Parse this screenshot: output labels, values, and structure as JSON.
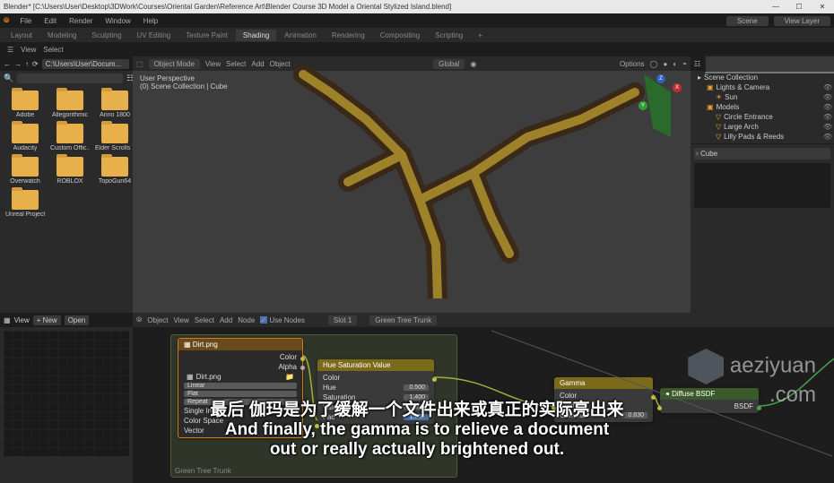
{
  "title": "Blender* [C:\\Users\\User\\Desktop\\3DWork\\Courses\\Oriental Garden\\Reference Art\\Blender Course 3D Model a Oriental Stylized Island.blend]",
  "menubar": [
    "File",
    "Edit",
    "Render",
    "Window",
    "Help"
  ],
  "workspaces": [
    "Layout",
    "Modeling",
    "Sculpting",
    "UV Editing",
    "Texture Paint",
    "Shading",
    "Animation",
    "Rendering",
    "Compositing",
    "Scripting"
  ],
  "workspace_active": "Shading",
  "scene_label": "Scene",
  "viewlayer_label": "View Layer",
  "topbar": {
    "view": "View",
    "select": "Select"
  },
  "filebrowser": {
    "path": "C:\\Users\\User\\Docum...",
    "search_placeholder": "",
    "folders": [
      "Adobe",
      "Allegorithmic",
      "Anno 1800",
      "Audacity",
      "Custom Offic...",
      "Elder Scrolls ...",
      "Overwatch",
      "ROBLOX",
      "TopoGun64",
      "Unreal Project..."
    ]
  },
  "viewport": {
    "mode": "Object Mode",
    "menus": [
      "View",
      "Select",
      "Add",
      "Object"
    ],
    "orient": "Global",
    "info1": "User Perspective",
    "info2": "(0) Scene Collection | Cube",
    "options": "Options"
  },
  "outliner": {
    "root": "Scene Collection",
    "items": [
      {
        "label": "Lights & Camera",
        "lvl": 0,
        "icon": "collection"
      },
      {
        "label": "Sun",
        "lvl": 1,
        "icon": "light"
      },
      {
        "label": "Models",
        "lvl": 0,
        "icon": "collection"
      },
      {
        "label": "Circle Entrance",
        "lvl": 1,
        "icon": "mesh"
      },
      {
        "label": "Large Arch",
        "lvl": 1,
        "icon": "mesh"
      },
      {
        "label": "Lilly Pads & Reeds",
        "lvl": 1,
        "icon": "mesh"
      }
    ],
    "prop_item": "Cube"
  },
  "image_editor": {
    "view": "View",
    "new": "New",
    "open": "Open"
  },
  "node_editor": {
    "menus": [
      "Object",
      "View",
      "Select",
      "Add",
      "Node"
    ],
    "use_nodes_label": "Use Nodes",
    "use_nodes": true,
    "slot": "Slot 1",
    "material": "Green Tree Trunk",
    "frame_label": "Green Tree Trunk",
    "nodes": {
      "dirt_title": "Dirt.png",
      "dirt_outputs": [
        "Color",
        "Alpha"
      ],
      "dirt_file": "Dirt.png",
      "dirt_interp": "Linear",
      "dirt_proj": "Flat",
      "dirt_ext": "Repeat",
      "dirt_source": "Single Imag",
      "dirt_cspace": "Color Space",
      "dirt_vector": "Vector",
      "hsv_title": "Hue Saturation Value",
      "hsv_rows": [
        {
          "label": "Color",
          "val": ""
        },
        {
          "label": "Hue",
          "val": "0.500"
        },
        {
          "label": "Saturation",
          "val": "1.400"
        },
        {
          "label": "Value",
          "val": "1.300"
        },
        {
          "label": "Fac",
          "val": "1.000",
          "sel": true
        }
      ],
      "gamma_title": "Gamma",
      "gamma_rows": [
        {
          "label": "Color",
          "val": ""
        },
        {
          "label": "Color",
          "val": ""
        },
        {
          "label": "Gamma",
          "val": "0.830"
        }
      ],
      "bsdf_title": "Diffuse BSDF",
      "bsdf_out": "BSDF"
    }
  },
  "subtitles": {
    "cn": "最后 伽玛是为了缓解一个文件出来或真正的实际亮出来",
    "en1": "And finally, the gamma is to relieve a document",
    "en2": "out or really actually brightened out."
  },
  "watermark": {
    "line1": "aeziyuan",
    "line2": ".com"
  }
}
